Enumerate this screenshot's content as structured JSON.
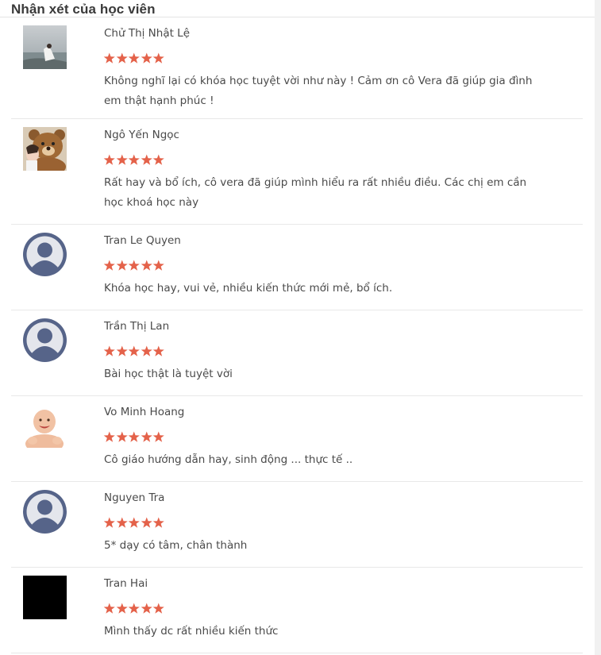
{
  "section": {
    "title": "Nhận xét của học viên"
  },
  "colors": {
    "star": "#e4624a",
    "avatar_placeholder_bg": "#e4e6ec",
    "avatar_placeholder_fg": "#566489"
  },
  "reviews": [
    {
      "name": "Chử Thị Nhật Lệ",
      "rating": 5,
      "avatar": "photo-girl-by-sea-icon",
      "comment": "Không nghĩ lại có khóa học tuyệt vời như này ! Cảm ơn cô Vera đã giúp gia đình em thật hạnh phúc !"
    },
    {
      "name": "Ngô Yến Ngọc",
      "rating": 5,
      "avatar": "photo-teddy-bear-icon",
      "comment": "Rất hay và bổ ích, cô vera đã giúp mình hiểu ra rất nhiều điều. Các chị em cần học khoá học này"
    },
    {
      "name": "Tran Le Quyen",
      "rating": 5,
      "avatar": "default-user-icon",
      "comment": "Khóa học hay, vui vẻ, nhiều kiến thức mới mẻ, bổ ích."
    },
    {
      "name": "Trần Thị Lan",
      "rating": 5,
      "avatar": "default-user-icon",
      "comment": "Bài học thật là tuyệt vời"
    },
    {
      "name": "Vo Minh Hoang",
      "rating": 5,
      "avatar": "photo-baby-icon",
      "comment": "Cô giáo hướng dẫn hay, sinh động ... thực tế .."
    },
    {
      "name": "Nguyen Tra",
      "rating": 5,
      "avatar": "default-user-icon",
      "comment": "5* dạy có tâm, chân thành"
    },
    {
      "name": "Tran Hai",
      "rating": 5,
      "avatar": "black-square-icon",
      "comment": "Mình thấy dc rất nhiều kiến thức"
    }
  ]
}
